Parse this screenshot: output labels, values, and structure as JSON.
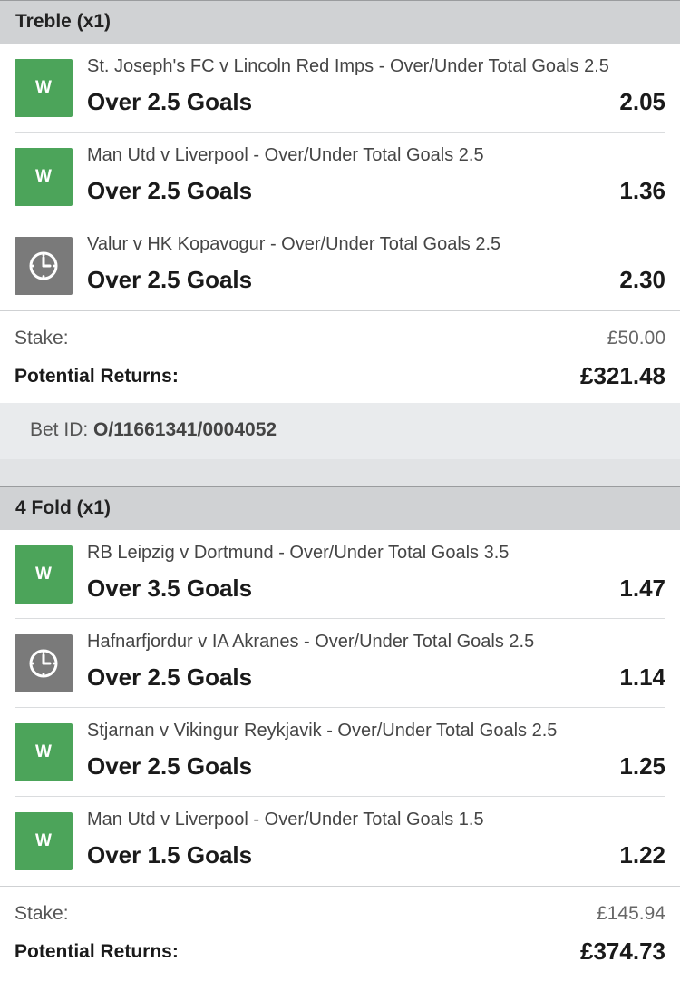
{
  "bets": [
    {
      "header": "Treble (x1)",
      "selections": [
        {
          "status": "W",
          "event": "St. Joseph's FC v Lincoln Red Imps - Over/Under Total Goals 2.5",
          "market": "Over 2.5 Goals",
          "odds": "2.05"
        },
        {
          "status": "W",
          "event": "Man Utd v Liverpool - Over/Under Total Goals 2.5",
          "market": "Over 2.5 Goals",
          "odds": "1.36"
        },
        {
          "status": "pending",
          "event": "Valur v HK Kopavogur - Over/Under Total Goals 2.5",
          "market": "Over 2.5 Goals",
          "odds": "2.30"
        }
      ],
      "stake_label": "Stake:",
      "stake": "£50.00",
      "returns_label": "Potential Returns:",
      "returns": "£321.48",
      "bet_id_label": "Bet ID:",
      "bet_id": "O/11661341/0004052"
    },
    {
      "header": "4 Fold (x1)",
      "selections": [
        {
          "status": "W",
          "event": "RB Leipzig v Dortmund - Over/Under Total Goals 3.5",
          "market": "Over 3.5 Goals",
          "odds": "1.47"
        },
        {
          "status": "pending",
          "event": "Hafnarfjordur v IA Akranes - Over/Under Total Goals 2.5",
          "market": "Over 2.5 Goals",
          "odds": "1.14"
        },
        {
          "status": "W",
          "event": "Stjarnan v Vikingur Reykjavik - Over/Under Total Goals 2.5",
          "market": "Over 2.5 Goals",
          "odds": "1.25"
        },
        {
          "status": "W",
          "event": "Man Utd v Liverpool - Over/Under Total Goals 1.5",
          "market": "Over 1.5 Goals",
          "odds": "1.22"
        }
      ],
      "stake_label": "Stake:",
      "stake": "£145.94",
      "returns_label": "Potential Returns:",
      "returns": "£374.73"
    }
  ],
  "colors": {
    "win": "#4ca45a",
    "pending": "#7a7a7a",
    "header_bg": "#d0d2d4"
  },
  "icons": {
    "pending": "clock-icon"
  }
}
